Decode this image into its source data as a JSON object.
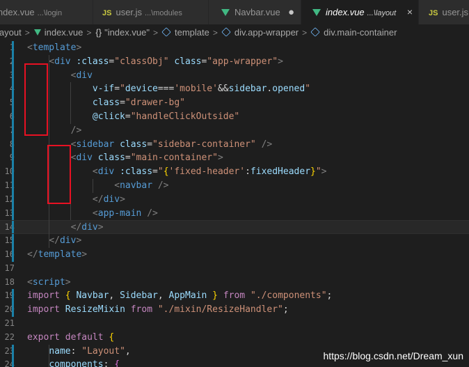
{
  "tabs": [
    {
      "name": "index.vue",
      "desc": "...\\login",
      "icon": "vue-icon",
      "active": false
    },
    {
      "name": "user.js",
      "desc": "...\\modules",
      "icon": "js-icon",
      "active": false
    },
    {
      "name": "Navbar.vue",
      "desc": "",
      "icon": "vue-icon",
      "active": false,
      "modified": true
    },
    {
      "name": "index.vue",
      "desc": "...\\layout",
      "icon": "vue-icon",
      "active": true
    },
    {
      "name": "user.js",
      "desc": "",
      "icon": "js-icon",
      "active": false
    }
  ],
  "js_badge": "JS",
  "breadcrumb": {
    "items": [
      "layout",
      "index.vue",
      "\"index.vue\"",
      "template",
      "div.app-wrapper",
      "div.main-container"
    ],
    "braces": "{}"
  },
  "glyphs": {
    "modified": "●",
    "close": "×",
    "separator": ">"
  },
  "line_numbers": [
    "1",
    "2",
    "3",
    "4",
    "5",
    "6",
    "7",
    "8",
    "9",
    "10",
    "11",
    "12",
    "13",
    "14",
    "15",
    "16",
    "17",
    "18",
    "19",
    "20",
    "21",
    "22",
    "23",
    "24"
  ],
  "code_lines": [
    [
      [
        "t-punc",
        "<"
      ],
      [
        "t-tag",
        "template"
      ],
      [
        "t-punc",
        ">"
      ]
    ],
    [
      [
        "t-plain",
        "    "
      ],
      [
        "t-punc",
        "<"
      ],
      [
        "t-tag",
        "div"
      ],
      [
        "t-plain",
        " "
      ],
      [
        "t-attr",
        ":class"
      ],
      [
        "t-plain",
        "="
      ],
      [
        "t-str",
        "\"classObj\""
      ],
      [
        "t-plain",
        " "
      ],
      [
        "t-attr",
        "class"
      ],
      [
        "t-plain",
        "="
      ],
      [
        "t-str",
        "\"app-wrapper\""
      ],
      [
        "t-punc",
        ">"
      ]
    ],
    [
      [
        "t-plain",
        "        "
      ],
      [
        "t-punc",
        "<"
      ],
      [
        "t-tag",
        "div"
      ]
    ],
    [
      [
        "t-plain",
        "            "
      ],
      [
        "t-attr",
        "v-if"
      ],
      [
        "t-plain",
        "="
      ],
      [
        "t-str",
        "\""
      ],
      [
        "t-var",
        "device"
      ],
      [
        "t-plain",
        "==="
      ],
      [
        "t-str",
        "'mobile'"
      ],
      [
        "t-plain",
        "&&"
      ],
      [
        "t-var",
        "sidebar"
      ],
      [
        "t-plain",
        "."
      ],
      [
        "t-var",
        "opened"
      ],
      [
        "t-str",
        "\""
      ]
    ],
    [
      [
        "t-plain",
        "            "
      ],
      [
        "t-attr",
        "class"
      ],
      [
        "t-plain",
        "="
      ],
      [
        "t-str",
        "\"drawer-bg\""
      ]
    ],
    [
      [
        "t-plain",
        "            "
      ],
      [
        "t-attr",
        "@click"
      ],
      [
        "t-plain",
        "="
      ],
      [
        "t-str",
        "\"handleClickOutside\""
      ]
    ],
    [
      [
        "t-plain",
        "        "
      ],
      [
        "t-punc",
        "/>"
      ]
    ],
    [
      [
        "t-plain",
        "        "
      ],
      [
        "t-punc",
        "<"
      ],
      [
        "t-tag",
        "sidebar"
      ],
      [
        "t-plain",
        " "
      ],
      [
        "t-attr",
        "class"
      ],
      [
        "t-plain",
        "="
      ],
      [
        "t-str",
        "\"sidebar-container\""
      ],
      [
        "t-plain",
        " "
      ],
      [
        "t-punc",
        "/>"
      ]
    ],
    [
      [
        "t-plain",
        "        "
      ],
      [
        "t-punc",
        "<"
      ],
      [
        "t-tag",
        "div"
      ],
      [
        "t-plain",
        " "
      ],
      [
        "t-attr",
        "class"
      ],
      [
        "t-plain",
        "="
      ],
      [
        "t-str",
        "\"main-container\""
      ],
      [
        "t-punc",
        ">"
      ]
    ],
    [
      [
        "t-plain",
        "            "
      ],
      [
        "t-punc",
        "<"
      ],
      [
        "t-tag",
        "div"
      ],
      [
        "t-plain",
        " "
      ],
      [
        "t-attr",
        ":class"
      ],
      [
        "t-plain",
        "="
      ],
      [
        "t-str",
        "\""
      ],
      [
        "t-bracket",
        "{"
      ],
      [
        "t-str",
        "'fixed-header'"
      ],
      [
        "t-plain",
        ":"
      ],
      [
        "t-var",
        "fixedHeader"
      ],
      [
        "t-bracket",
        "}"
      ],
      [
        "t-str",
        "\""
      ],
      [
        "t-punc",
        ">"
      ]
    ],
    [
      [
        "t-plain",
        "                "
      ],
      [
        "t-punc",
        "<"
      ],
      [
        "t-tag",
        "navbar"
      ],
      [
        "t-plain",
        " "
      ],
      [
        "t-punc",
        "/>"
      ]
    ],
    [
      [
        "t-plain",
        "            "
      ],
      [
        "t-punc",
        "</"
      ],
      [
        "t-tag",
        "div"
      ],
      [
        "t-punc",
        ">"
      ]
    ],
    [
      [
        "t-plain",
        "            "
      ],
      [
        "t-punc",
        "<"
      ],
      [
        "t-tag",
        "app-main"
      ],
      [
        "t-plain",
        " "
      ],
      [
        "t-punc",
        "/>"
      ]
    ],
    [
      [
        "t-plain",
        "        "
      ],
      [
        "t-punc",
        "</"
      ],
      [
        "t-tag",
        "div"
      ],
      [
        "t-punc",
        ">"
      ]
    ],
    [
      [
        "t-plain",
        "    "
      ],
      [
        "t-punc",
        "</"
      ],
      [
        "t-tag",
        "div"
      ],
      [
        "t-punc",
        ">"
      ]
    ],
    [
      [
        "t-punc",
        "</"
      ],
      [
        "t-tag",
        "template"
      ],
      [
        "t-punc",
        ">"
      ]
    ],
    [],
    [
      [
        "t-punc",
        "<"
      ],
      [
        "t-tag",
        "script"
      ],
      [
        "t-punc",
        ">"
      ]
    ],
    [
      [
        "t-kw",
        "import"
      ],
      [
        "t-plain",
        " "
      ],
      [
        "t-bracket",
        "{"
      ],
      [
        "t-plain",
        " "
      ],
      [
        "t-var",
        "Navbar"
      ],
      [
        "t-plain",
        ", "
      ],
      [
        "t-var",
        "Sidebar"
      ],
      [
        "t-plain",
        ", "
      ],
      [
        "t-var",
        "AppMain"
      ],
      [
        "t-plain",
        " "
      ],
      [
        "t-bracket",
        "}"
      ],
      [
        "t-plain",
        " "
      ],
      [
        "t-kw",
        "from"
      ],
      [
        "t-plain",
        " "
      ],
      [
        "t-str",
        "\"./components\""
      ],
      [
        "t-plain",
        ";"
      ]
    ],
    [
      [
        "t-kw",
        "import"
      ],
      [
        "t-plain",
        " "
      ],
      [
        "t-var",
        "ResizeMixin"
      ],
      [
        "t-plain",
        " "
      ],
      [
        "t-kw",
        "from"
      ],
      [
        "t-plain",
        " "
      ],
      [
        "t-str",
        "\"./mixin/ResizeHandler\""
      ],
      [
        "t-plain",
        ";"
      ]
    ],
    [],
    [
      [
        "t-kw",
        "export"
      ],
      [
        "t-plain",
        " "
      ],
      [
        "t-kw",
        "default"
      ],
      [
        "t-plain",
        " "
      ],
      [
        "t-bracket",
        "{"
      ]
    ],
    [
      [
        "t-plain",
        "    "
      ],
      [
        "t-var",
        "name"
      ],
      [
        "t-plain",
        ": "
      ],
      [
        "t-str",
        "\"Layout\""
      ],
      [
        "t-plain",
        ","
      ]
    ],
    [
      [
        "t-plain",
        "    "
      ],
      [
        "t-var",
        "components"
      ],
      [
        "t-plain",
        ": "
      ],
      [
        "t-obj",
        "{"
      ]
    ]
  ],
  "watermark": "https://blog.csdn.net/Dream_xun"
}
